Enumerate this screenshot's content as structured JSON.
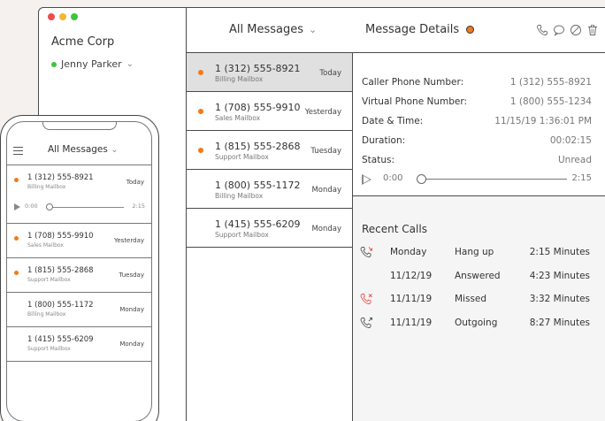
{
  "window": {
    "traffic_lights": [
      "#ef4b4b",
      "#f5b731",
      "#3ec43e"
    ],
    "company": "Acme Corp",
    "user": "Jenny Parker",
    "status_color": "#3ec43e"
  },
  "header": {
    "list_title": "All Messages",
    "detail_title": "Message Details",
    "icons": [
      "phone-icon",
      "chat-icon",
      "block-icon",
      "trash-icon"
    ]
  },
  "messages": [
    {
      "number": "1 (312) 555-8921",
      "mailbox": "Billing Mailbox",
      "when": "Today",
      "unread": true,
      "selected": true
    },
    {
      "number": "1 (708) 555-9910",
      "mailbox": "Sales Mailbox",
      "when": "Yesterday",
      "unread": true,
      "selected": false
    },
    {
      "number": "1 (815) 555-2868",
      "mailbox": "Support Mailbox",
      "when": "Tuesday",
      "unread": true,
      "selected": false
    },
    {
      "number": "1 (800) 555-1172",
      "mailbox": "Billing Mailbox",
      "when": "Monday",
      "unread": false,
      "selected": false
    },
    {
      "number": "1 (415) 555-6209",
      "mailbox": "Support Mailbox",
      "when": "Monday",
      "unread": false,
      "selected": false
    }
  ],
  "details": {
    "rows": [
      {
        "label": "Caller Phone Number:",
        "value": "1 (312) 555-8921"
      },
      {
        "label": "Virtual Phone Number:",
        "value": "1 (800) 555-1234"
      },
      {
        "label": "Date & Time:",
        "value": "11/15/19 1:36:01 PM"
      },
      {
        "label": "Duration:",
        "value": "00:02:15"
      },
      {
        "label": "Status:",
        "value": "Unread"
      }
    ],
    "player": {
      "start": "0:00",
      "end": "2:15",
      "progress": 0
    }
  },
  "recent": {
    "title": "Recent Calls",
    "calls": [
      {
        "date": "Monday",
        "status": "Hang up",
        "minutes": "2:15 Minutes",
        "icon": "hangup-call-icon",
        "color": "#555"
      },
      {
        "date": "11/12/19",
        "status": "Answered",
        "minutes": "4:23 Minutes",
        "icon": "",
        "color": "#555"
      },
      {
        "date": "11/11/19",
        "status": "Missed",
        "minutes": "3:32 Minutes",
        "icon": "missed-call-icon",
        "color": "#e8524a"
      },
      {
        "date": "11/11/19",
        "status": "Outgoing",
        "minutes": "8:27 Minutes",
        "icon": "outgoing-call-icon",
        "color": "#555"
      }
    ]
  },
  "phone": {
    "title": "All Messages",
    "player": {
      "start": "0:00",
      "end": "2:15"
    },
    "messages": [
      {
        "number": "1 (312) 555-8921",
        "mailbox": "Billing Mailbox",
        "when": "Today",
        "unread": true
      },
      {
        "number": "1 (708) 555-9910",
        "mailbox": "Sales Mailbox",
        "when": "Yesterday",
        "unread": true
      },
      {
        "number": "1 (815) 555-2868",
        "mailbox": "Support Mailbox",
        "when": "Tuesday",
        "unread": true
      },
      {
        "number": "1 (800) 555-1172",
        "mailbox": "Billing Mailbox",
        "when": "Monday",
        "unread": false
      },
      {
        "number": "1 (415) 555-6209",
        "mailbox": "Support Mailbox",
        "when": "Monday",
        "unread": false
      }
    ]
  }
}
